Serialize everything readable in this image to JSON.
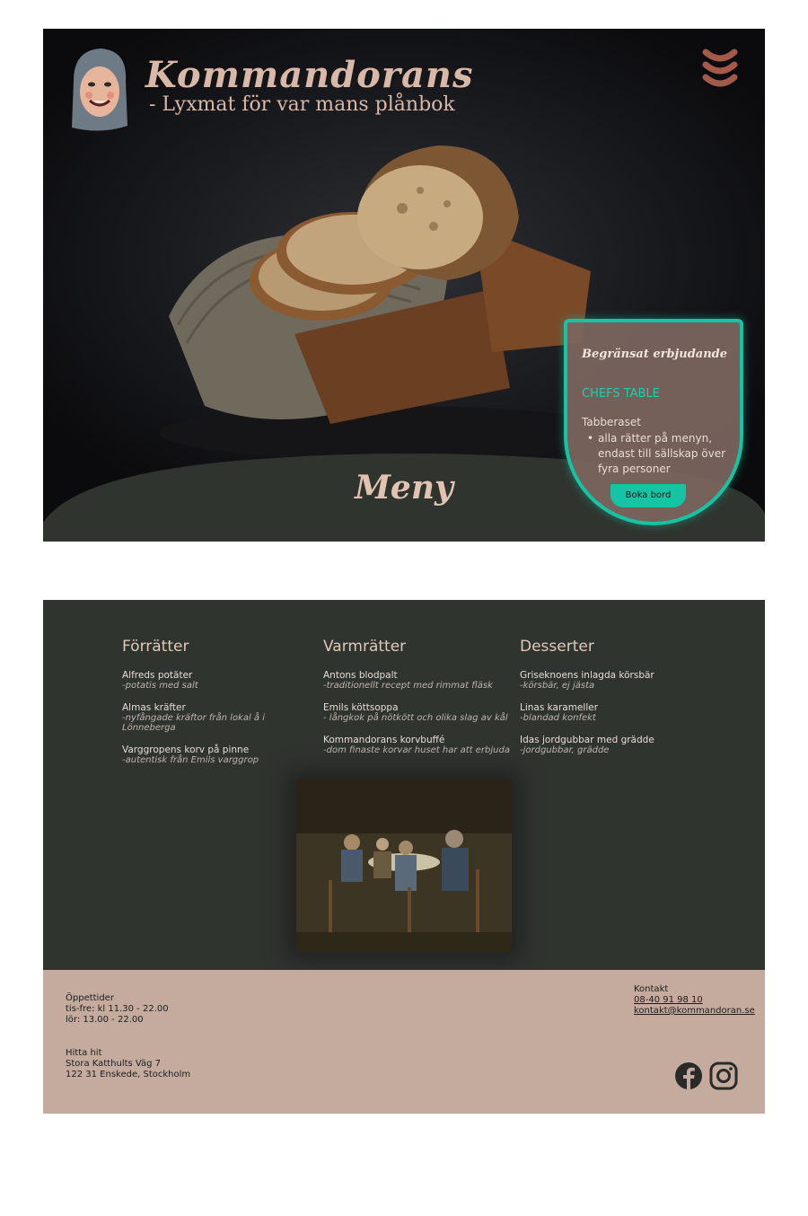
{
  "header": {
    "brand_title": "Kommandorans",
    "brand_subtitle": "- Lyxmat för var mans plånbok",
    "menu_icon": "sausage-menu-icon"
  },
  "hero": {
    "section_title": "Meny"
  },
  "offer": {
    "title": "Begränsat erbjudande",
    "name": "CHEFS TABLE",
    "subtitle": "Tabberaset",
    "bullet": "alla rätter på menyn, endast till sällskap över fyra personer",
    "button": "Boka bord"
  },
  "menu": {
    "columns": [
      {
        "heading": "Förrätter",
        "items": [
          {
            "name": "Alfreds potäter",
            "desc": " -potatis med salt"
          },
          {
            "name": "Almas kräfter",
            "desc": "-nyfångade kräftor från lokal å i Lönneberga"
          },
          {
            "name": "Varggropens korv på pinne",
            "desc": "-autentisk från Emils varggrop"
          }
        ]
      },
      {
        "heading": "Varmrätter",
        "items": [
          {
            "name": "Antons blodpalt",
            "desc": "-traditionellt recept med rimmat fläsk"
          },
          {
            "name": "Emils köttsoppa",
            "desc": "- långkok på nötkött och olika slag av kål"
          },
          {
            "name": "Kommandorans korvbuffé",
            "desc": "-dom finaste korvar huset har att erbjuda"
          }
        ]
      },
      {
        "heading": "Desserter",
        "items": [
          {
            "name": "Griseknoens inlagda körsbär",
            "desc": "-körsbär, ej jästa"
          },
          {
            "name": "Linas karameller",
            "desc": "-blandad konfekt"
          },
          {
            "name": "Idas jordgubbar med grädde",
            "desc": "-jordgubbar, grädde"
          }
        ]
      }
    ]
  },
  "footer": {
    "hours_title": "Öppettider",
    "hours_line1": "tis-fre: kl 11.30 - 22.00",
    "hours_line2": "lör: 13.00 - 22.00",
    "find_title": "Hitta hit",
    "address_line1": "Stora Katthults Väg 7",
    "address_line2": "122 31 Enskede, Stockholm",
    "contact_title": "Kontakt",
    "phone": "08-40 91 98 10",
    "email": "kontakt@kommandoran.se",
    "social_icons": [
      "facebook-icon",
      "instagram-icon"
    ]
  },
  "colors": {
    "accent": "#16c4a4",
    "brand_text": "#d9b8a8",
    "menu_bg": "#30342f",
    "footer_bg": "#c4ab9e"
  }
}
